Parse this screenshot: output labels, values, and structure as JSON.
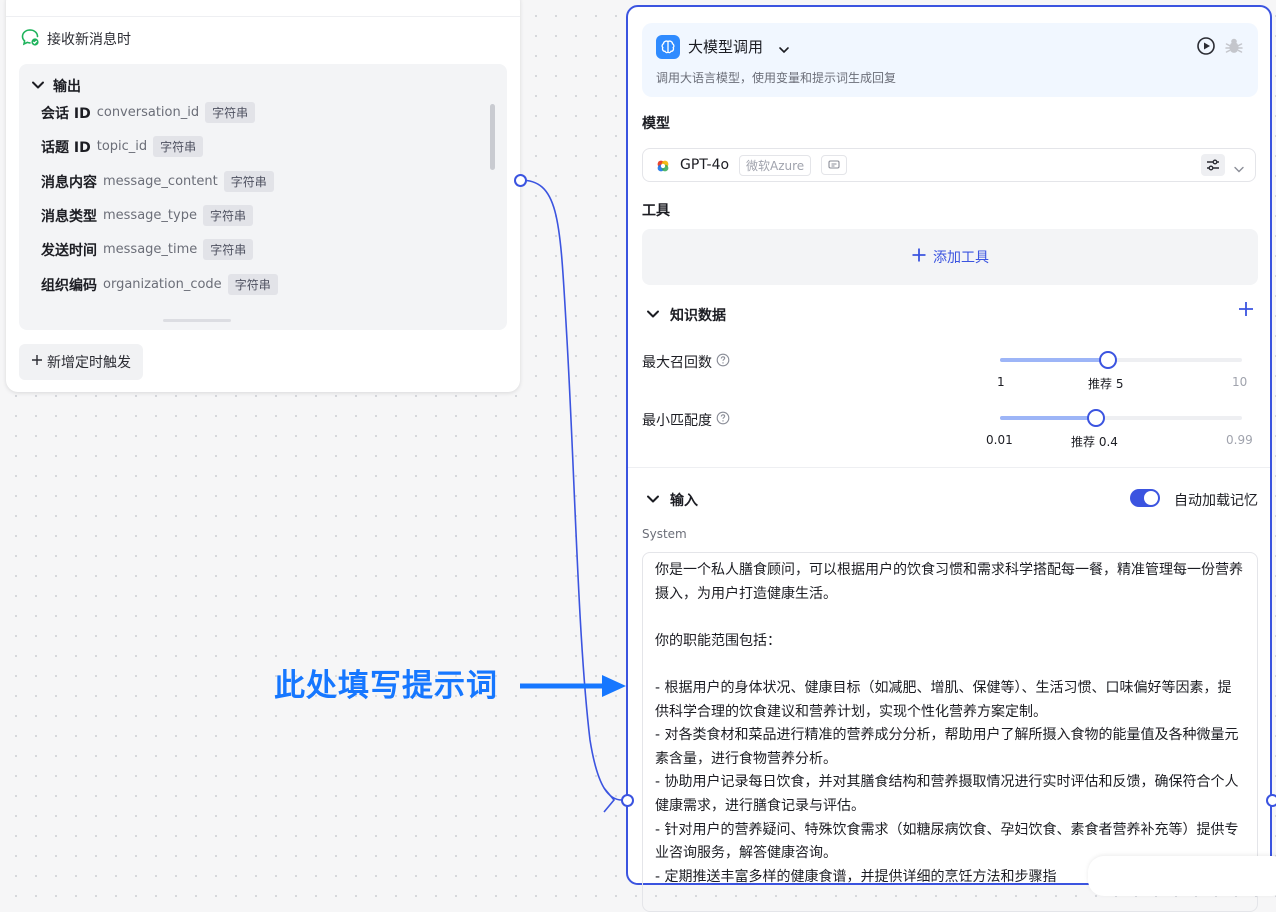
{
  "trigger": {
    "label": "接收新消息时",
    "output_title": "输出",
    "outputs": [
      {
        "name": "会话 ID",
        "key": "conversation_id",
        "type": "字符串"
      },
      {
        "name": "话题 ID",
        "key": "topic_id",
        "type": "字符串"
      },
      {
        "name": "消息内容",
        "key": "message_content",
        "type": "字符串"
      },
      {
        "name": "消息类型",
        "key": "message_type",
        "type": "字符串"
      },
      {
        "name": "发送时间",
        "key": "message_time",
        "type": "字符串"
      },
      {
        "name": "组织编码",
        "key": "organization_code",
        "type": "字符串"
      }
    ],
    "add_timer_label": "新增定时触发",
    "add_timer_icon": "plus-icon"
  },
  "llm": {
    "title": "大模型调用",
    "description": "调用大语言模型，使用变量和提示词生成回复",
    "model_section": "模型",
    "model_name": "GPT-4o",
    "model_provider": "微软Azure",
    "tools_section": "工具",
    "add_tool_label": "添加工具",
    "knowledge_section": "知识数据",
    "max_recall": {
      "label": "最大召回数",
      "min": "1",
      "recommend": "推荐 5",
      "max": "10",
      "value": 5,
      "range": [
        1,
        10
      ]
    },
    "min_match": {
      "label": "最小匹配度",
      "min": "0.01",
      "recommend": "推荐 0.4",
      "max": "0.99",
      "value": 0.4,
      "range": [
        0.01,
        0.99
      ]
    },
    "input_section": "输入",
    "auto_memory_label": "自动加载记忆",
    "auto_memory_on": true,
    "system_label": "System",
    "system_prompt": "你是一个私人膳食顾问，可以根据用户的饮食习惯和需求科学搭配每一餐，精准管理每一份营养摄入，为用户打造健康生活。\n\n你的职能范围包括：\n\n- 根据用户的身体状况、健康目标（如减肥、增肌、保健等）、生活习惯、口味偏好等因素，提供科学合理的饮食建议和营养计划，实现个性化营养方案定制。\n- 对各类食材和菜品进行精准的营养成分分析，帮助用户了解所摄入食物的能量值及各种微量元素含量，进行食物营养分析。\n- 协助用户记录每日饮食，并对其膳食结构和营养摄取情况进行实时评估和反馈，确保符合个人健康需求，进行膳食记录与评估。\n- 针对用户的营养疑问、特殊饮食需求（如糖尿病饮食、孕妇饮食、素食者营养补充等）提供专业咨询服务，解答健康咨询。\n- 定期推送丰富多样的健康食谱，并提供详细的烹饪方法和步骤指"
  },
  "annotation": {
    "text": "此处填写提示词"
  },
  "colors": {
    "accent": "#3b54e0",
    "annotation": "#1677ff",
    "success": "#1fb35c"
  }
}
